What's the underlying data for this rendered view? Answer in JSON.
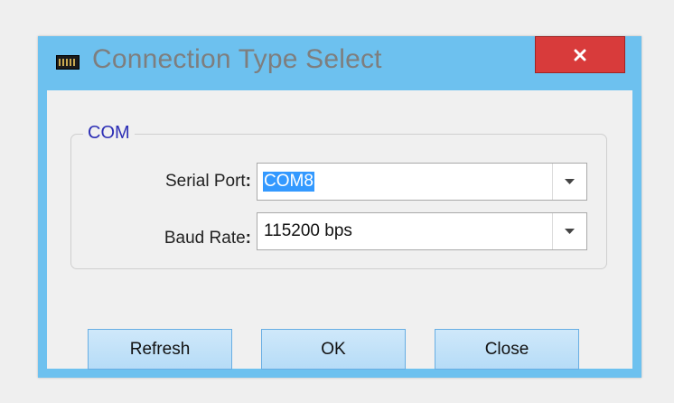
{
  "window": {
    "title": "Connection Type Select",
    "close_icon": "close-x-icon"
  },
  "group": {
    "legend": "COM"
  },
  "fields": {
    "serial_port": {
      "label": "Serial Port",
      "colon": ":",
      "value": "COM8"
    },
    "baud_rate": {
      "label": "Baud Rate",
      "colon": ":",
      "value": "115200 bps"
    }
  },
  "buttons": {
    "refresh": "Refresh",
    "ok": "OK",
    "close": "Close"
  },
  "colors": {
    "frame": "#6dc1ef",
    "close_button": "#d83b3b",
    "legend_text": "#2d2fb5",
    "selection": "#3399ff",
    "button_bg": "#b6dcf7"
  }
}
